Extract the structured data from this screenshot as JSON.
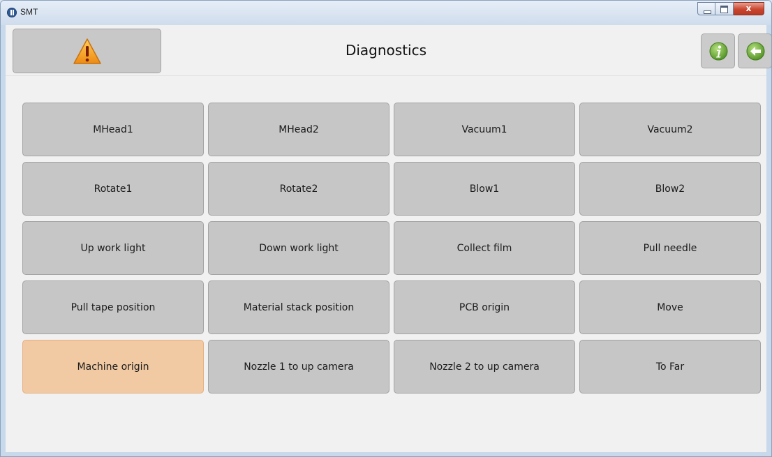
{
  "window": {
    "title": "SMT",
    "close_symbol": "x",
    "icons": [
      "app-icon",
      "minimize-icon",
      "maximize-icon",
      "close-icon"
    ]
  },
  "header": {
    "title": "Diagnostics",
    "left_icon": "warning-icon",
    "right_icons": [
      "info-icon",
      "back-arrow-icon"
    ]
  },
  "colors": {
    "button_bg": "#c6c6c6",
    "selected_bg": "#f1c9a3",
    "warning": "#f29a1f",
    "icon_green": "#76b33b"
  },
  "grid": {
    "selected": "Machine origin",
    "buttons": [
      "MHead1",
      "MHead2",
      "Vacuum1",
      "Vacuum2",
      "Rotate1",
      "Rotate2",
      "Blow1",
      "Blow2",
      "Up work light",
      "Down work light",
      "Collect film",
      "Pull needle",
      "Pull tape position",
      "Material stack position",
      "PCB origin",
      "Move",
      "Machine origin",
      "Nozzle 1 to up camera",
      "Nozzle 2 to up camera",
      "To Far"
    ]
  }
}
